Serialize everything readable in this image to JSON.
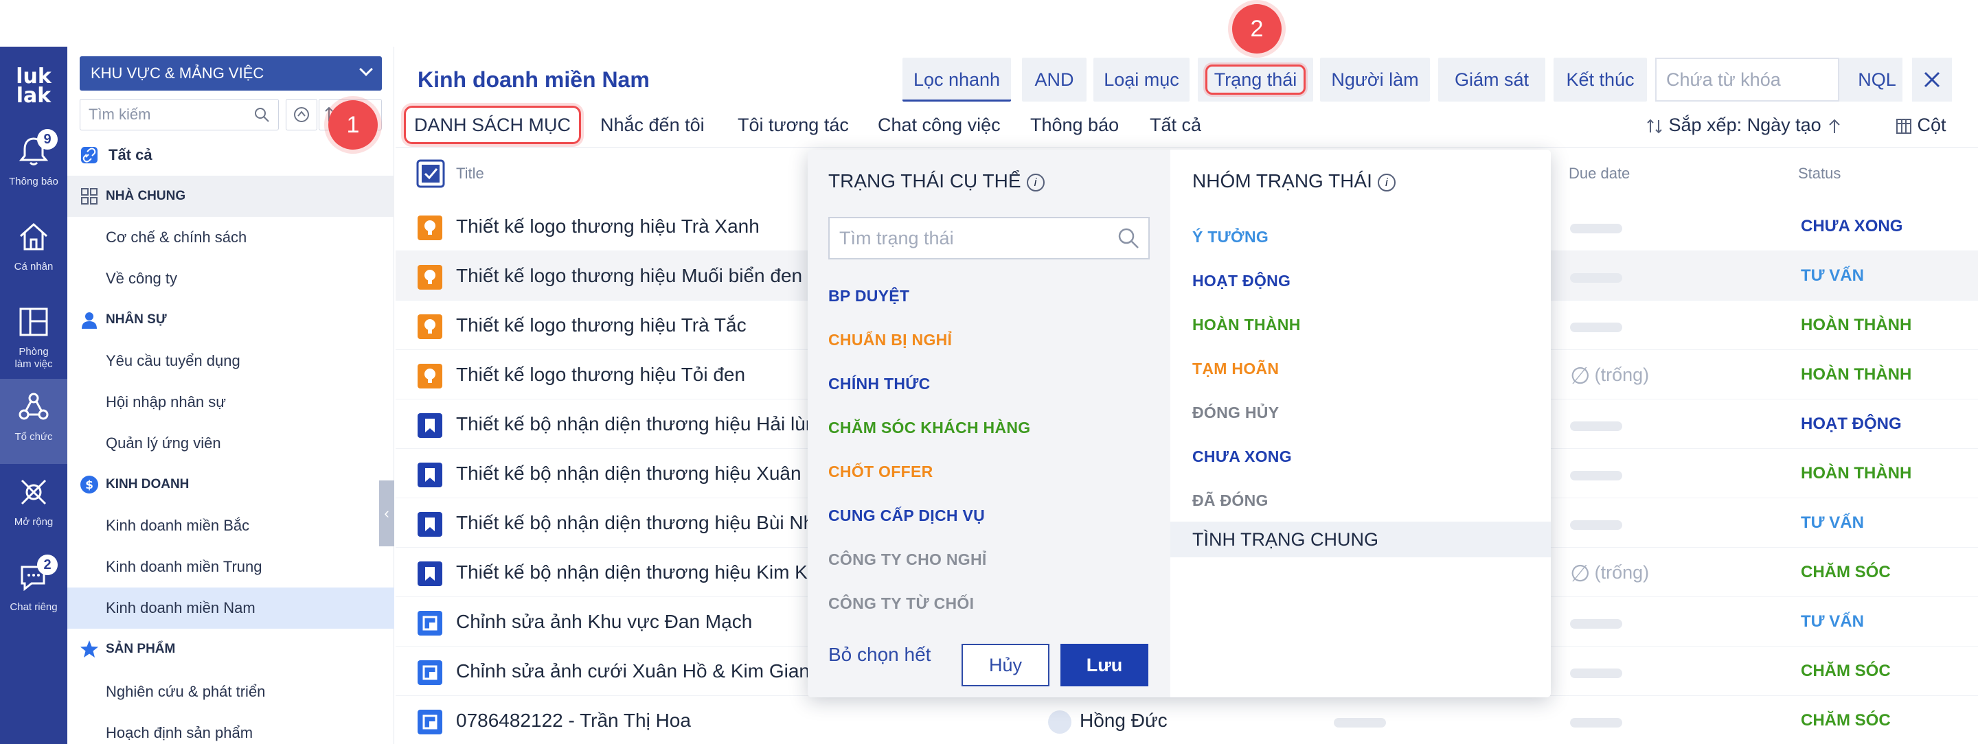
{
  "rail": {
    "logo": "luk lak",
    "items": [
      {
        "label": "Thông báo",
        "icon": "bell-icon",
        "badge": "9"
      },
      {
        "label": "Cá nhân",
        "icon": "home-icon"
      },
      {
        "label": "Phòng làm việc",
        "icon": "layout-icon"
      },
      {
        "label": "Tổ chức",
        "icon": "organization-icon"
      },
      {
        "label": "Mở rộng",
        "icon": "extension-icon"
      },
      {
        "label": "Chat riêng",
        "icon": "chat-icon",
        "badge": "2"
      }
    ]
  },
  "sidebar": {
    "workspace": "KHU VỰC & MẢNG VIỆC",
    "search_placeholder": "Tìm kiếm",
    "all_label": "Tất cả",
    "groups": [
      {
        "label": "NHÀ CHUNG",
        "items": [
          "Cơ chế & chính sách",
          "Về công ty"
        ]
      },
      {
        "label": "NHÂN SỰ",
        "items": [
          "Yêu cầu tuyển dụng",
          "Hội nhập nhân sự",
          "Quản lý ứng viên"
        ]
      },
      {
        "label": "KINH DOANH",
        "items": [
          "Kinh doanh miền Bắc",
          "Kinh doanh miền Trung",
          "Kinh doanh miền Nam"
        ]
      },
      {
        "label": "SẢN PHẨM",
        "items": [
          "Nghiên cứu & phát triển",
          "Hoạch định sản phẩm"
        ]
      }
    ],
    "selected": "Kinh doanh miền Nam"
  },
  "steps": [
    "1",
    "2"
  ],
  "header": {
    "title": "Kinh doanh miền Nam",
    "filters": [
      "Lọc nhanh",
      "AND",
      "Loại mục",
      "Trạng thái",
      "Người làm",
      "Giám sát",
      "Kết thúc"
    ],
    "keyword_placeholder": "Chứa từ khóa",
    "nql": "NQL",
    "close": "X"
  },
  "tabs": [
    "DANH SÁCH MỤC",
    "Nhắc đến tôi",
    "Tôi tương tác",
    "Chat công việc",
    "Thông báo",
    "Tất cả"
  ],
  "sort": {
    "label": "Sắp xếp: Ngày tạo",
    "columns_label": "Cột"
  },
  "table": {
    "headers": {
      "title": "Title",
      "due": "Due date",
      "status": "Status"
    },
    "rows": [
      {
        "title": "Thiết kế logo thương hiệu Trà Xanh",
        "icon": "idea-icon",
        "status": "CHƯA XONG",
        "due": "",
        "color": "#1f3fb0"
      },
      {
        "title": "Thiết kế logo thương hiệu Muối biển đen",
        "icon": "idea-icon",
        "status": "TƯ VẤN",
        "due": "",
        "color": "#3a8fe0"
      },
      {
        "title": "Thiết kế logo thương hiệu Trà Tắc",
        "icon": "idea-icon",
        "status": "HOÀN THÀNH",
        "due": "",
        "color": "#3d9a1f"
      },
      {
        "title": "Thiết kế logo thương hiệu Tỏi đen",
        "icon": "idea-icon",
        "status": "HOÀN THÀNH",
        "due": "(trống)",
        "color": "#3d9a1f"
      },
      {
        "title": "Thiết kế bộ nhận diện thương hiệu Hải lùn",
        "icon": "bookmark-icon",
        "status": "HOẠT ĐỘNG",
        "due": "",
        "color": "#1f3fb0"
      },
      {
        "title": "Thiết kế bộ nhận diện thương hiệu Xuân Hồ",
        "icon": "bookmark-icon",
        "status": "HOÀN THÀNH",
        "due": "",
        "color": "#3d9a1f"
      },
      {
        "title": "Thiết kế bộ nhận diện thương hiệu Bùi Nhân",
        "icon": "bookmark-icon",
        "status": "TƯ VẤN",
        "due": "",
        "color": "#3a8fe0"
      },
      {
        "title": "Thiết kế bộ nhận diện thương hiệu Kim Khánh",
        "icon": "bookmark-icon",
        "status": "CHĂM SÓC",
        "due": "(trống)",
        "color": "#3d9a1f"
      },
      {
        "title": "Chỉnh sửa ảnh Khu vực Đan Mạch",
        "icon": "task-icon",
        "status": "TƯ VẤN",
        "due": "",
        "color": "#3a8fe0"
      },
      {
        "title": "Chỉnh sửa ảnh cưới Xuân Hồ & Kim Giang",
        "icon": "task-icon",
        "status": "CHĂM SÓC",
        "due": "",
        "color": "#3d9a1f"
      },
      {
        "title": "0786482122 - Trần Thị Hoa",
        "icon": "task-icon",
        "status": "CHĂM SÓC",
        "due": "",
        "color": "#3d9a1f",
        "assignee": "Hồng Đức"
      }
    ]
  },
  "dropdown": {
    "left_title": "TRẠNG THÁI CỤ THỂ",
    "right_title": "NHÓM TRẠNG THÁI",
    "search_placeholder": "Tìm trạng thái",
    "specific": [
      {
        "label": "BP DUYỆT",
        "color": "#1f3fb0"
      },
      {
        "label": "CHUẨN BỊ NGHỈ",
        "color": "#f28a1c"
      },
      {
        "label": "CHÍNH THỨC",
        "color": "#1f3fb0"
      },
      {
        "label": "CHĂM SÓC KHÁCH HÀNG",
        "color": "#3d9a1f"
      },
      {
        "label": "CHỐT OFFER",
        "color": "#f28a1c"
      },
      {
        "label": "CUNG CẤP DỊCH VỤ",
        "color": "#1f3fb0"
      },
      {
        "label": "CÔNG TY CHO NGHỈ",
        "color": "#8a8f99"
      },
      {
        "label": "CÔNG TY TỪ CHỐI",
        "color": "#8a8f99"
      }
    ],
    "groups": [
      {
        "label": "Ý TƯỞNG",
        "color": "#3a8fe0"
      },
      {
        "label": "HOẠT ĐỘNG",
        "color": "#1f3fb0"
      },
      {
        "label": "HOÀN THÀNH",
        "color": "#3d9a1f"
      },
      {
        "label": "TẠM HOÃN",
        "color": "#f28a1c"
      },
      {
        "label": "ĐÓNG HỦY",
        "color": "#7d828c"
      },
      {
        "label": "CHƯA XONG",
        "color": "#1f3fb0"
      },
      {
        "label": "ĐÃ ĐÓNG",
        "color": "#7d828c"
      }
    ],
    "general": "TÌNH TRẠNG CHUNG",
    "clear_all": "Bỏ chọn hết",
    "cancel": "Hủy",
    "save": "Lưu"
  }
}
